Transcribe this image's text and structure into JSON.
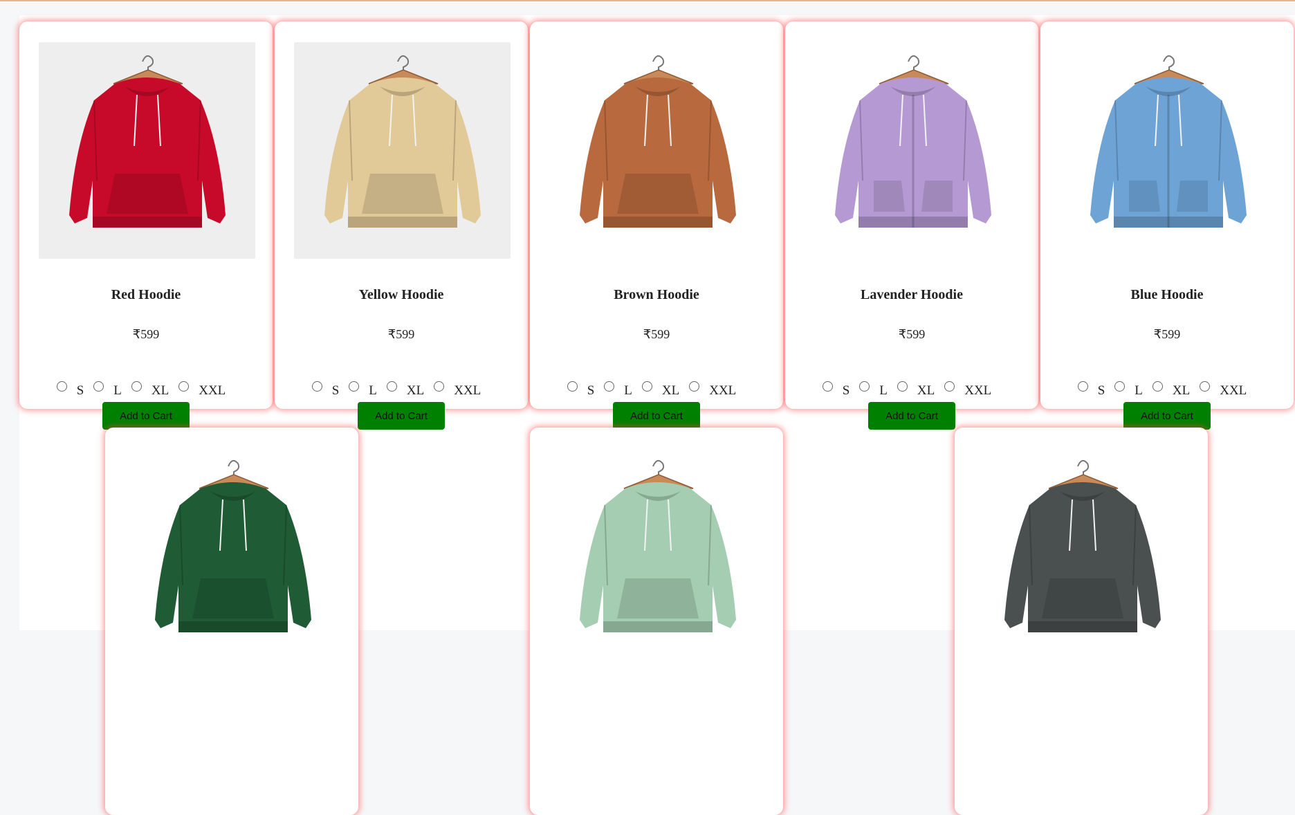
{
  "products": [
    {
      "name": "Red Hoodie",
      "price": "₹599",
      "color": "#c80a2a",
      "bg": "grey",
      "zip": false
    },
    {
      "name": "Yellow Hoodie",
      "price": "₹599",
      "color": "#e2c998",
      "bg": "grey",
      "zip": false
    },
    {
      "name": "Brown Hoodie",
      "price": "₹599",
      "color": "#b86a3e",
      "bg": "white",
      "zip": false
    },
    {
      "name": "Lavender Hoodie",
      "price": "₹599",
      "color": "#b599d2",
      "bg": "white",
      "zip": true
    },
    {
      "name": "Blue Hoodie",
      "price": "₹599",
      "color": "#6ea3d6",
      "bg": "white",
      "zip": true
    },
    {
      "name": "",
      "price": "",
      "color": "#1f5c35",
      "bg": "white",
      "zip": false
    },
    {
      "name": "",
      "price": "",
      "color": "#a4cdb1",
      "bg": "white",
      "zip": false
    },
    {
      "name": "",
      "price": "",
      "color": "#4a4f4f",
      "bg": "white",
      "zip": false
    }
  ],
  "sizes": [
    "S",
    "L",
    "XL",
    "XXL"
  ],
  "add_to_cart_label": "Add to Cart",
  "colors": {
    "button": "#008000",
    "card_glow": "#ff3c3c",
    "top_border": "#e3b48f"
  }
}
